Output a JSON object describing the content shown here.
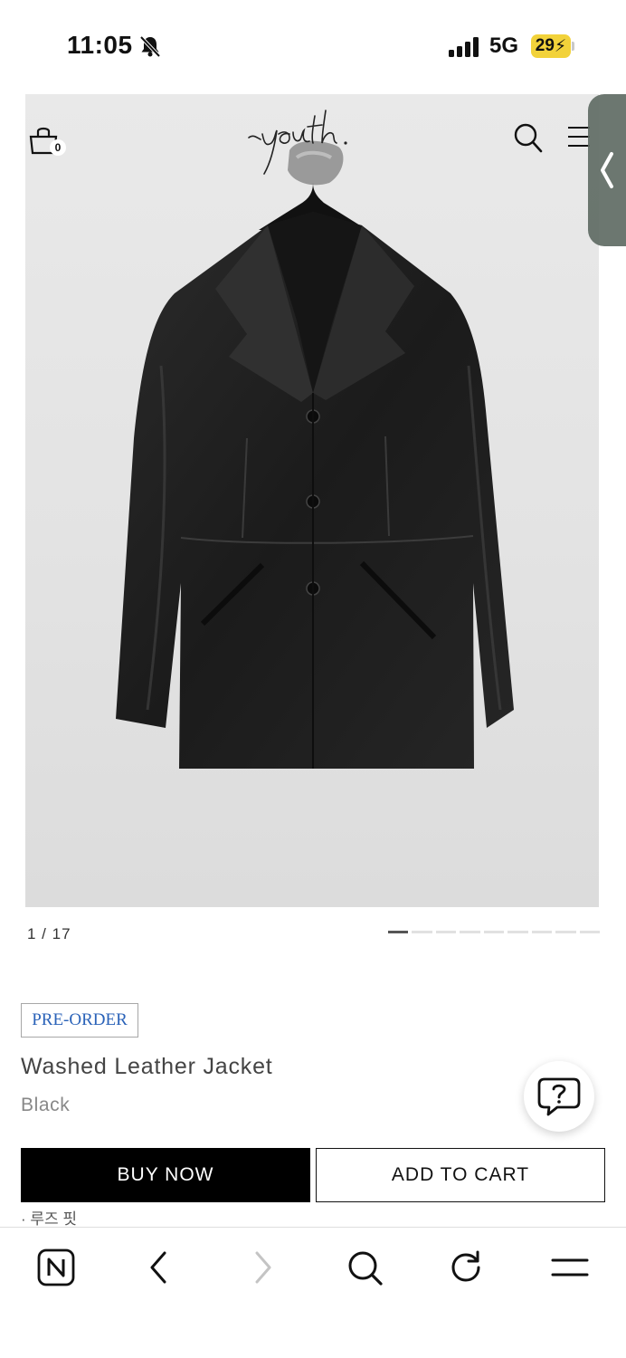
{
  "status_bar": {
    "time": "11:05",
    "network": "5G",
    "battery_level": "29"
  },
  "header": {
    "cart_count": "0",
    "brand_logo_text": "youth."
  },
  "gallery": {
    "pager_text": "1 / 17",
    "total_images": 17,
    "current_index": 1
  },
  "product": {
    "badge": "PRE-ORDER",
    "name": "Washed Leather Jacket",
    "color": "Black",
    "fit_note": "· 루즈 핏"
  },
  "actions": {
    "buy_now_label": "BUY NOW",
    "add_to_cart_label": "ADD TO CART"
  },
  "help": {
    "icon": "question-chat-icon"
  },
  "browser_bar": {
    "items": [
      "naver-home-icon",
      "back-arrow-icon",
      "forward-arrow-icon",
      "search-icon",
      "reload-icon",
      "menu-icon"
    ]
  },
  "colors": {
    "badge_text": "#2a62b8",
    "battery": "#f2d23a",
    "button_dark": "#000000"
  }
}
